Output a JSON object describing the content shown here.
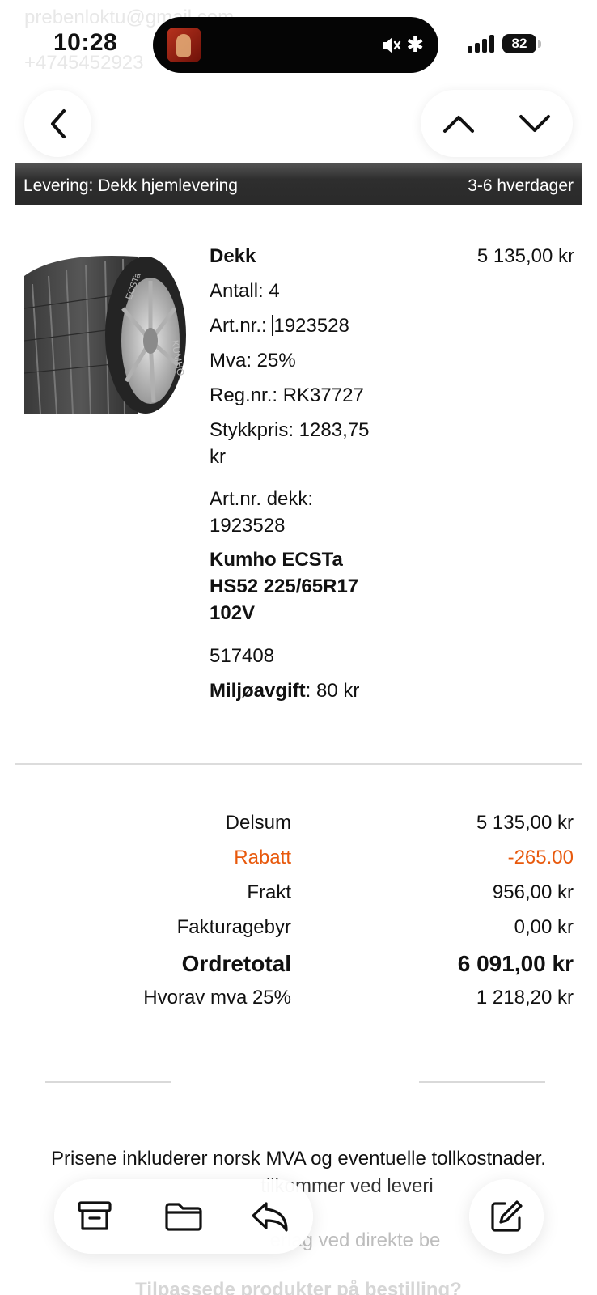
{
  "background": {
    "email_line_1": "prebenloktu@gmail.com",
    "email_line_2": "+4745452923"
  },
  "status_bar": {
    "time": "10:28",
    "battery": "82",
    "bluetooth_glyph": "✱"
  },
  "icons": {
    "back": "chevron-left-icon",
    "up": "chevron-up-icon",
    "down": "chevron-down-icon",
    "archive": "archive-icon",
    "folder": "folder-icon",
    "reply": "reply-icon",
    "compose": "compose-icon"
  },
  "delivery": {
    "label": "Levering: Dekk hjemlevering",
    "time": "3-6 hverdager"
  },
  "product": {
    "name": "Dekk",
    "price": "5 135,00 kr",
    "quantity": "Antall: 4",
    "art_prefix": "Art.nr.: ",
    "art_value": "1923528",
    "vat": "Mva: 25%",
    "reg": "Reg.nr.: RK37727",
    "unit_price_1": "Stykkpris: 1283,75",
    "unit_price_2": "kr",
    "tire_art_1": "Art.nr. dekk:",
    "tire_art_2": "1923528",
    "model_1": "Kumho ECSTa",
    "model_2": "HS52 225/65R17",
    "model_3": "102V",
    "code": "517408",
    "env_fee_label": "Miljøavgift",
    "env_fee_value": ": 80 kr",
    "tire_brand_text": "KUMHO",
    "tire_model_text": "ECSTa"
  },
  "totals": {
    "subtotal_label": "Delsum",
    "subtotal_value": "5 135,00 kr",
    "discount_label": "Rabatt",
    "discount_value": "-265.00",
    "shipping_label": "Frakt",
    "shipping_value": "956,00 kr",
    "invoice_fee_label": "Fakturagebyr",
    "invoice_fee_value": "0,00 kr",
    "order_total_label": "Ordretotal",
    "order_total_value": "6 091,00 kr",
    "vat_label": "Hvorav mva 25%",
    "vat_value": "1 218,20 kr"
  },
  "notes": {
    "line1": "Prisene inkluderer norsk MVA og eventuelle tollkostnader.",
    "line2": "tilkommer ved leveri",
    "line3": "erlag ved direkte be",
    "line4": "Tilpassede produkter på bestilling?"
  },
  "colors": {
    "discount": "#e8590c",
    "delivery_bar": "#2e2e2e"
  }
}
